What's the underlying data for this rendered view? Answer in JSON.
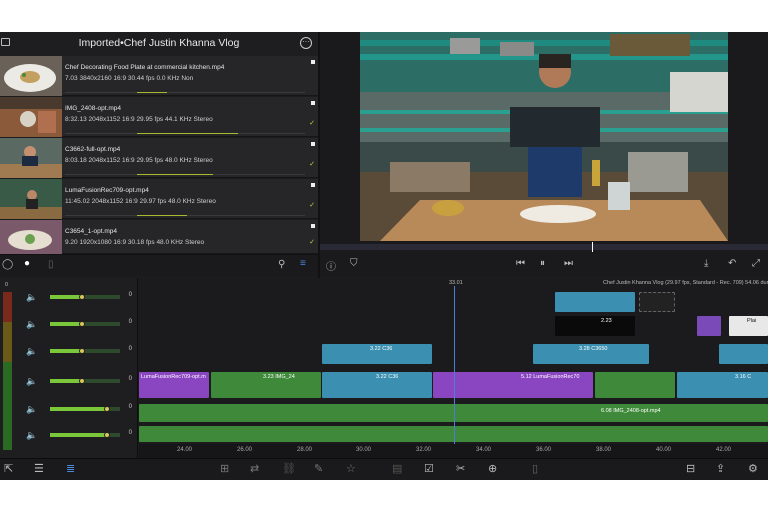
{
  "library": {
    "title": "Imported•Chef Justin Khanna Vlog",
    "clips": [
      {
        "name": "Chef Decorating Food Plate at commercial kitchen.mp4",
        "meta": "7.03 3840x2160 16:9 30.44 fps 0.0 KHz Non",
        "used": 0.18,
        "checked": false
      },
      {
        "name": "IMG_2408-opt.mp4",
        "meta": "8:32.13 2048x1152 16:9 29.95 fps 44.1 KHz Stereo",
        "used": 0.6,
        "checked": true
      },
      {
        "name": "C3662-full-opt.mp4",
        "meta": "8:03.18 2048x1152 16:9 29.95 fps 48.0 KHz Stereo",
        "used": 0.45,
        "checked": true
      },
      {
        "name": "LumaFusionRec709-opt.mp4",
        "meta": "11:45.02 2048x1152 16:9 29.97 fps 48.0 KHz Stereo",
        "used": 0.3,
        "checked": true
      },
      {
        "name": "C3654_1-opt.mp4",
        "meta": "9.20 1920x1080 16:9 30.18 fps 48.0 KHz Stereo",
        "used": 0.15,
        "checked": true
      }
    ]
  },
  "project_info": "Chef Justin Khanna Vlog (29.97 fps, Standard - Rec. 709) 54.06 duration",
  "playhead_time": "33.01",
  "mixer": [
    {
      "label": "0",
      "level": 0.45
    },
    {
      "label": "0",
      "level": 0.45
    },
    {
      "label": "0",
      "level": 0.45
    },
    {
      "label": "0",
      "level": 0.45
    },
    {
      "label": "0",
      "level": 0.82
    },
    {
      "label": "0",
      "level": 0.82
    }
  ],
  "mixer_top": "0",
  "ruler": [
    "24.00",
    "26.00",
    "28.00",
    "30.00",
    "32.00",
    "34.00",
    "36.00",
    "38.00",
    "40.00",
    "42.00"
  ],
  "clips": {
    "c1": "3.22 C36",
    "c2": "2.23",
    "c3": "3.28 C3650",
    "c4": "3.22 C36",
    "c5": "LumaFusionRec709-opt.m",
    "c6": "3.23 IMG_24",
    "c7": "5.12 LumaFusionRec70",
    "c8": "3.16 C",
    "c9": "6.08 IMG_2408-opt.mp4",
    "c10": "2.88",
    "c11": "Plai"
  },
  "colors": {
    "accent": "#4a7fd8",
    "video_clip": "#3b8fb0",
    "audio_clip": "#3f8a3a",
    "purple_clip": "#8a45c0",
    "meter_green": "#7ac83a"
  },
  "icons": {
    "folder": "folder-icon",
    "more": "more-icon",
    "play": "play-icon",
    "cut": "scissors-icon"
  }
}
